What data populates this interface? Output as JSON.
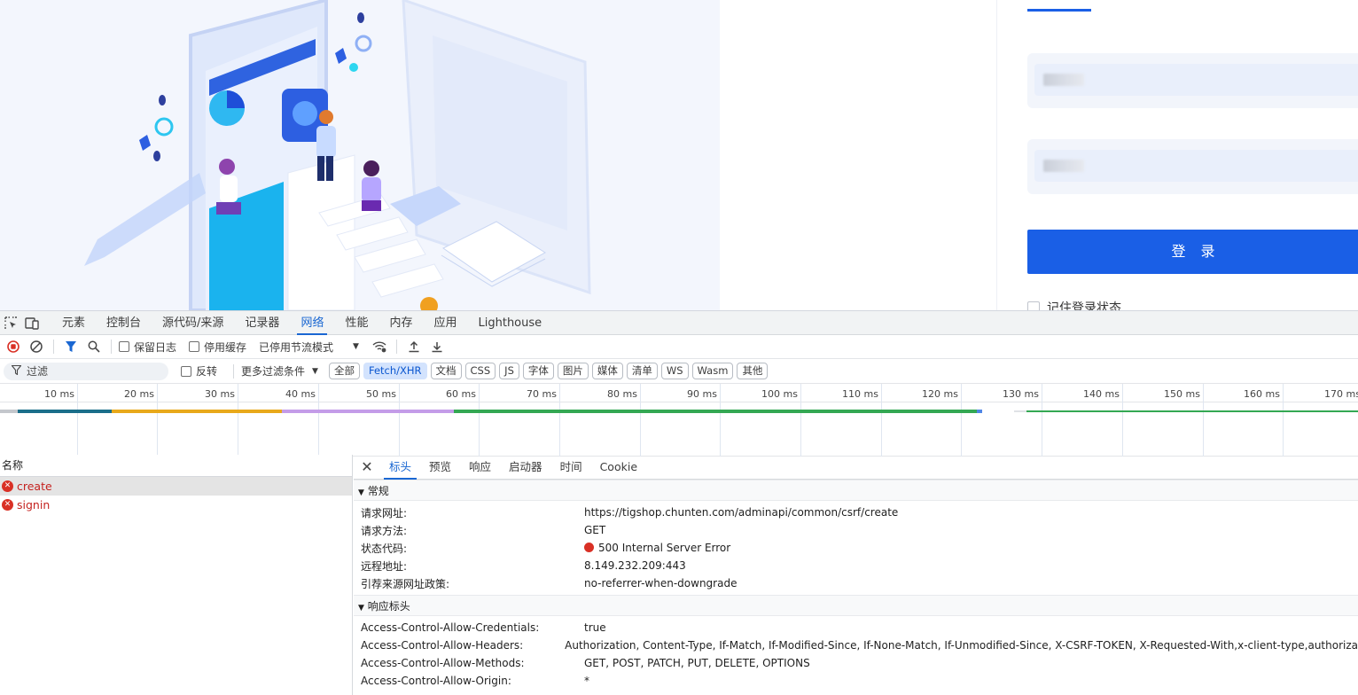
{
  "login": {
    "button_label": "登 录",
    "remember_label": "记住登录状态"
  },
  "devtools": {
    "tabs": [
      "元素",
      "控制台",
      "源代码/来源",
      "记录器",
      "网络",
      "性能",
      "内存",
      "应用",
      "Lighthouse"
    ],
    "active_tab": "网络",
    "toolbar": {
      "preserve_log": "保留日志",
      "disable_cache": "停用缓存",
      "throttle": "已停用节流模式"
    },
    "filter": {
      "placeholder": "过滤",
      "invert": "反转",
      "more_filters": "更多过滤条件",
      "chips": [
        "全部",
        "Fetch/XHR",
        "文档",
        "CSS",
        "JS",
        "字体",
        "图片",
        "媒体",
        "清单",
        "WS",
        "Wasm",
        "其他"
      ],
      "active_chip": "Fetch/XHR"
    },
    "timeline": {
      "ticks": [
        "10 ms",
        "20 ms",
        "30 ms",
        "40 ms",
        "50 ms",
        "60 ms",
        "70 ms",
        "80 ms",
        "90 ms",
        "100 ms",
        "110 ms",
        "120 ms",
        "130 ms",
        "140 ms",
        "150 ms",
        "160 ms",
        "170 ms"
      ]
    },
    "requests": {
      "header": "名称",
      "items": [
        {
          "name": "create",
          "error": true,
          "selected": true
        },
        {
          "name": "signin",
          "error": true,
          "selected": false
        }
      ]
    },
    "details": {
      "tabs": [
        "标头",
        "预览",
        "响应",
        "启动器",
        "时间",
        "Cookie"
      ],
      "active_tab": "标头",
      "general": {
        "title": "常规",
        "rows": [
          {
            "key": "请求网址:",
            "value": "https://tigshop.chunten.com/adminapi/common/csrf/create"
          },
          {
            "key": "请求方法:",
            "value": "GET"
          },
          {
            "key": "状态代码:",
            "value": "500 Internal Server Error"
          },
          {
            "key": "远程地址:",
            "value": "8.149.232.209:443"
          },
          {
            "key": "引荐来源网址政策:",
            "value": "no-referrer-when-downgrade"
          }
        ]
      },
      "response_headers": {
        "title": "响应标头",
        "rows": [
          {
            "key": "Access-Control-Allow-Credentials:",
            "value": "true"
          },
          {
            "key": "Access-Control-Allow-Headers:",
            "value": "Authorization, Content-Type, If-Match, If-Modified-Since, If-None-Match, If-Unmodified-Since, X-CSRF-TOKEN, X-Requested-With,x-client-type,authoriza"
          },
          {
            "key": "Access-Control-Allow-Methods:",
            "value": "GET, POST, PATCH, PUT, DELETE, OPTIONS"
          },
          {
            "key": "Access-Control-Allow-Origin:",
            "value": "*"
          }
        ]
      }
    }
  }
}
